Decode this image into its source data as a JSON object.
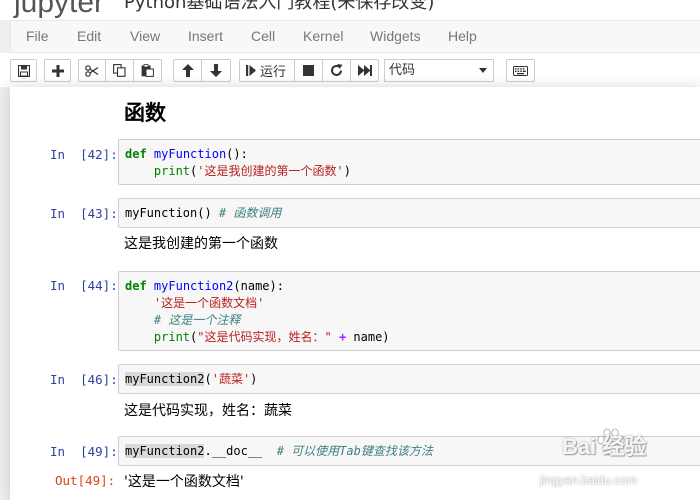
{
  "header": {
    "logo_text": "jupyter",
    "notebook_title": "Python基础语法入门教程(未保存改变)"
  },
  "menubar": {
    "items": [
      "File",
      "Edit",
      "View",
      "Insert",
      "Cell",
      "Kernel",
      "Widgets",
      "Help"
    ]
  },
  "toolbar": {
    "run_label": "运行",
    "cell_type": "代码",
    "icons": [
      "save-icon",
      "plus-icon",
      "cut-icon",
      "copy-icon",
      "paste-icon",
      "arrow-up-icon",
      "arrow-down-icon",
      "step-forward-icon",
      "stop-icon",
      "restart-icon",
      "fast-forward-icon",
      "keyboard-icon"
    ]
  },
  "notebook": {
    "heading": "函数",
    "cells": [
      {
        "prompt": "In  [42]:",
        "code": {
          "l1_kw": "def",
          "l1_fn": "myFunction",
          "l1_rest": "():",
          "l2_indent": "    ",
          "l2_bi": "print",
          "l2_open": "(",
          "l2_str": "'这是我创建的第一个函数'",
          "l2_close": ")"
        }
      },
      {
        "prompt": "In  [43]:",
        "code": {
          "l1_name": "myFunction() ",
          "l1_cm": "# 函数调用"
        },
        "output": "这是我创建的第一个函数"
      },
      {
        "prompt": "In  [44]:",
        "code": {
          "l1_kw": "def",
          "l1_fn": "myFunction2",
          "l1_rest": "(name):",
          "l2_str": "'这是一个函数文档'",
          "l3_cm": "# 这是一个注释",
          "l4_bi": "print",
          "l4_open": "(",
          "l4_str": "\"这是代码实现，姓名：\"",
          "l4_op": "+",
          "l4_rest": " name)"
        }
      },
      {
        "prompt": "In  [46]:",
        "code": {
          "l1_name": "myFunction2",
          "l1_open": "(",
          "l1_str": "'蔬菜'",
          "l1_close": ")"
        },
        "output": "这是代码实现，姓名：蔬菜"
      },
      {
        "prompt": "In  [49]:",
        "code": {
          "l1_name": "myFunction2",
          "l1_attr": ".__doc__  ",
          "l1_cm": "# 可以使用Tab键查找该方法"
        },
        "out_prompt": "Out[49]:",
        "output": "'这是一个函数文档'"
      }
    ]
  },
  "watermark": {
    "text": "Bai 经验",
    "url": "jingyan.baidu.com"
  },
  "colors": {
    "in_prompt": "#303f9f",
    "out_prompt": "#d84315",
    "keyword": "#008000",
    "function_name": "#0000ff",
    "string": "#ba2121",
    "comment": "#408080"
  }
}
